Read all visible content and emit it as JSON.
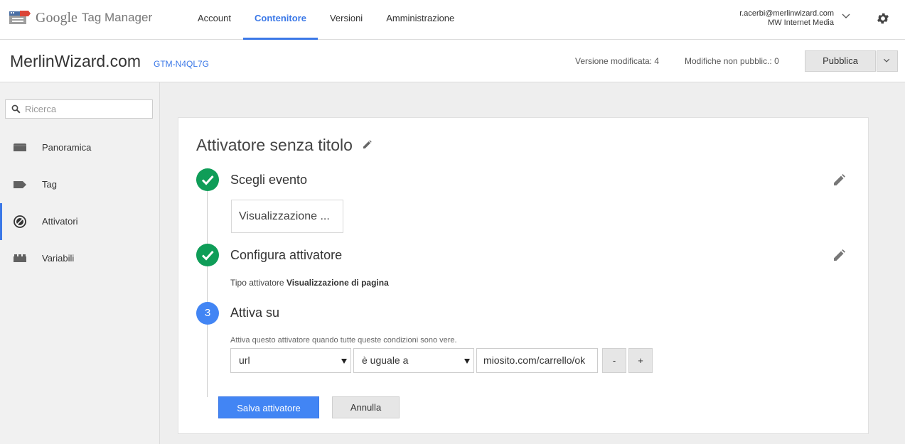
{
  "header": {
    "logo_google": "Google",
    "logo_product": "Tag Manager",
    "tabs": [
      {
        "label": "Account"
      },
      {
        "label": "Contenitore"
      },
      {
        "label": "Versioni"
      },
      {
        "label": "Amministrazione"
      }
    ],
    "active_tab": "Contenitore",
    "user_email": "r.acerbi@merlinwizard.com",
    "user_account": "MW Internet Media"
  },
  "container": {
    "name": "MerlinWizard.com",
    "id": "GTM-N4QL7G",
    "version_label": "Versione modificata: 4",
    "unpublished_label": "Modifiche non pubblic.: 0",
    "publish_label": "Pubblica"
  },
  "sidebar": {
    "search_placeholder": "Ricerca",
    "items": [
      {
        "label": "Panoramica",
        "icon": "folder-icon"
      },
      {
        "label": "Tag",
        "icon": "tag-icon"
      },
      {
        "label": "Attivatori",
        "icon": "trigger-icon"
      },
      {
        "label": "Variabili",
        "icon": "variables-icon"
      }
    ],
    "active_item": "Attivatori"
  },
  "editor": {
    "title": "Attivatore senza titolo",
    "steps": [
      {
        "title": "Scegli evento",
        "status": "done"
      },
      {
        "title": "Configura attivatore",
        "status": "done"
      },
      {
        "number": "3",
        "title": "Attiva su",
        "status": "current"
      }
    ],
    "event_box": "Visualizzazione ...",
    "trigger_type_label": "Tipo attivatore",
    "trigger_type_value": "Visualizzazione di pagina",
    "condition_hint": "Attiva questo attivatore quando tutte queste condizioni sono vere.",
    "condition": {
      "variable": "url",
      "operator": "è uguale a",
      "value": "miosito.com/carrello/ok"
    },
    "remove_label": "-",
    "add_label": "+",
    "save_label": "Salva attivatore",
    "cancel_label": "Annulla"
  },
  "colors": {
    "accent": "#3b78e7",
    "primary_button": "#4285f4",
    "done_green": "#0f9d58"
  }
}
